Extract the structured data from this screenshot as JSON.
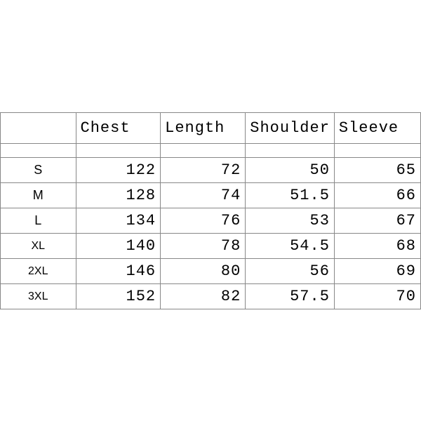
{
  "chart_data": {
    "type": "table",
    "headers": {
      "size": "",
      "chest": "Chest",
      "length": "Length",
      "shoulder": "Shoulder",
      "sleeve": "Sleeve"
    },
    "rows": [
      {
        "size": "S",
        "chest": "122",
        "length": "72",
        "shoulder": "50",
        "sleeve": "65"
      },
      {
        "size": "M",
        "chest": "128",
        "length": "74",
        "shoulder": "51.5",
        "sleeve": "66"
      },
      {
        "size": "L",
        "chest": "134",
        "length": "76",
        "shoulder": "53",
        "sleeve": "67"
      },
      {
        "size": "XL",
        "chest": "140",
        "length": "78",
        "shoulder": "54.5",
        "sleeve": "68"
      },
      {
        "size": "2XL",
        "chest": "146",
        "length": "80",
        "shoulder": "56",
        "sleeve": "69"
      },
      {
        "size": "3XL",
        "chest": "152",
        "length": "82",
        "shoulder": "57.5",
        "sleeve": "70"
      }
    ]
  }
}
